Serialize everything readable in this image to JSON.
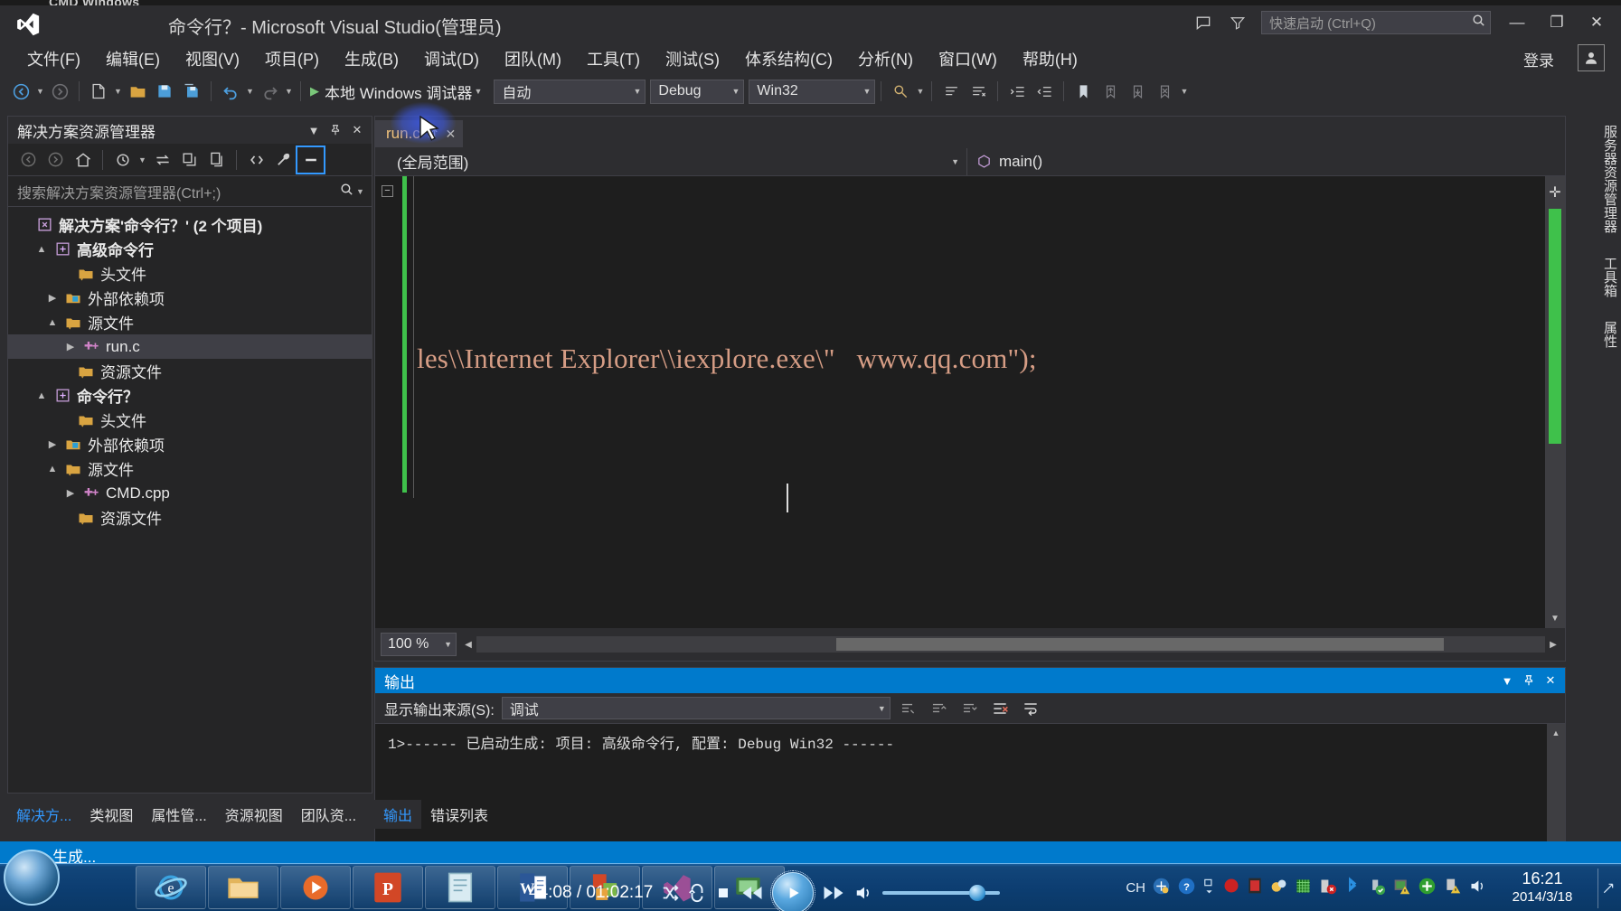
{
  "background": {
    "cmd_window_label": "CMD Windows"
  },
  "titlebar": {
    "title": "命令行？- Microsoft Visual Studio(管理员)",
    "logo_icon": "visual-studio-logo-icon",
    "feedback_icon": "feedback-icon",
    "filter_icon": "filter-icon",
    "quick_launch_placeholder": "快速启动 (Ctrl+Q)",
    "quick_launch_value": "",
    "search_icon": "search-icon",
    "minimize": "—",
    "restore": "❐",
    "close": "✕",
    "signin_label": "登录",
    "account_icon": "account-icon"
  },
  "menubar": {
    "items": [
      {
        "label": "文件(F)"
      },
      {
        "label": "编辑(E)"
      },
      {
        "label": "视图(V)"
      },
      {
        "label": "项目(P)"
      },
      {
        "label": "生成(B)"
      },
      {
        "label": "调试(D)"
      },
      {
        "label": "团队(M)"
      },
      {
        "label": "工具(T)"
      },
      {
        "label": "测试(S)"
      },
      {
        "label": "体系结构(C)"
      },
      {
        "label": "分析(N)"
      },
      {
        "label": "窗口(W)"
      },
      {
        "label": "帮助(H)"
      }
    ]
  },
  "toolbar": {
    "navigate_back_icon": "navigate-back-icon",
    "navigate_forward_icon": "navigate-forward-icon",
    "new_project_icon": "new-project-icon",
    "open_file_icon": "open-file-icon",
    "save_icon": "save-icon",
    "save_all_icon": "save-all-icon",
    "undo_icon": "undo-icon",
    "redo_icon": "redo-icon",
    "start_debug_label": "本地 Windows 调试器",
    "start_debug_icon": "play-icon",
    "debug_target": "自动",
    "configuration": "Debug",
    "platform": "Win32",
    "find_icon": "find-in-files-icon",
    "comment_icon": "comment-icon",
    "uncomment_icon": "uncomment-icon",
    "indent_icon": "indent-icon",
    "outdent_icon": "outdent-icon",
    "bookmark_icon": "bookmark-icon",
    "prev_bookmark_icon": "previous-bookmark-icon",
    "next_bookmark_icon": "next-bookmark-icon",
    "clear_bookmarks_icon": "clear-bookmarks-icon"
  },
  "solution_explorer": {
    "title": "解决方案资源管理器",
    "dropdown_icon": "chevron-down-icon",
    "pin_icon": "pin-icon",
    "close_icon": "close-icon",
    "toolbar": {
      "back_icon": "back-icon",
      "forward_icon": "forward-icon",
      "home_icon": "home-icon",
      "pending_changes_icon": "pending-changes-icon",
      "sync_icon": "sync-with-active-document-icon",
      "refresh_icon": "refresh-icon",
      "collapse_all_icon": "collapse-all-icon",
      "show_all_files_icon": "show-all-files-icon",
      "properties_icon": "properties-wrench-icon",
      "preview_icon": "preview-selected-items-icon"
    },
    "search_placeholder": "搜索解决方案资源管理器(Ctrl+;)",
    "search_value": "",
    "search_icon": "search-icon",
    "tree": [
      {
        "label": "解决方案'命令行？' (2 个项目)",
        "icon": "solution-icon",
        "depth": 0,
        "twisty": "",
        "bold": true,
        "selected": false
      },
      {
        "label": "高级命令行",
        "icon": "project-icon",
        "depth": 1,
        "twisty": "▲",
        "bold": true,
        "selected": false
      },
      {
        "label": "头文件",
        "icon": "folder-filter-icon",
        "depth": 2,
        "twisty": "",
        "bold": false,
        "selected": false
      },
      {
        "label": "外部依赖项",
        "icon": "folder-dependencies-icon",
        "depth": 2,
        "twisty": "▶",
        "bold": false,
        "selected": false
      },
      {
        "label": "源文件",
        "icon": "folder-source-icon",
        "depth": 2,
        "twisty": "▲",
        "bold": false,
        "selected": false
      },
      {
        "label": "run.c",
        "icon": "c-file-icon",
        "depth": 3,
        "twisty": "▶",
        "bold": false,
        "selected": true
      },
      {
        "label": "资源文件",
        "icon": "folder-filter-icon",
        "depth": 2,
        "twisty": "",
        "bold": false,
        "selected": false
      },
      {
        "label": "命令行？",
        "icon": "project-icon",
        "depth": 1,
        "twisty": "▲",
        "bold": true,
        "selected": false
      },
      {
        "label": "头文件",
        "icon": "folder-filter-icon",
        "depth": 2,
        "twisty": "",
        "bold": false,
        "selected": false
      },
      {
        "label": "外部依赖项",
        "icon": "folder-dependencies-icon",
        "depth": 2,
        "twisty": "▶",
        "bold": false,
        "selected": false
      },
      {
        "label": "源文件",
        "icon": "folder-source-icon",
        "depth": 2,
        "twisty": "▲",
        "bold": false,
        "selected": false
      },
      {
        "label": "CMD.cpp",
        "icon": "cpp-file-icon",
        "depth": 3,
        "twisty": "▶",
        "bold": false,
        "selected": false
      },
      {
        "label": "资源文件",
        "icon": "folder-filter-icon",
        "depth": 2,
        "twisty": "",
        "bold": false,
        "selected": false
      }
    ]
  },
  "editor": {
    "tab_label": "run.c",
    "tab_pin_icon": "pin-icon",
    "tab_close_icon": "close-icon",
    "nav_scope": "(全局范围)",
    "nav_member": "main()",
    "nav_member_icon": "method-icon",
    "code_prefix": "les\\\\Internet Explorer\\\\iexplore.exe\\",
    "code_quote": "\"",
    "code_suffix": "   www.qq.com\");",
    "code_full": "les\\\\Internet Explorer\\\\iexplore.exe\\\"   www.qq.com\");",
    "fold_glyph": "−",
    "zoom_level": "100 %",
    "zoom_caret_icon": "chevron-down-icon",
    "changed_marker_color": "#3fc14b",
    "scroll_left_icon": "scroll-left-icon",
    "scroll_right_icon": "scroll-right-icon"
  },
  "output_panel": {
    "title": "输出",
    "dropdown_icon": "chevron-down-icon",
    "pin_icon": "pin-icon",
    "close_icon": "close-icon",
    "source_label": "显示输出来源(S):",
    "source_value": "调试",
    "source_caret_icon": "chevron-down-icon",
    "find_message_icon": "find-message-icon",
    "go_to_prev_icon": "go-to-previous-message-icon",
    "go_to_next_icon": "go-to-next-message-icon",
    "clear_all_icon": "clear-all-icon",
    "toggle_wordwrap_icon": "toggle-word-wrap-icon",
    "lines": [
      "1>------ 已启动生成: 项目: 高级命令行, 配置: Debug Win32 ------"
    ]
  },
  "dock_tabs_left": [
    {
      "label": "解决方...",
      "active": true
    },
    {
      "label": "类视图",
      "active": false
    },
    {
      "label": "属性管...",
      "active": false
    },
    {
      "label": "资源视图",
      "active": false
    },
    {
      "label": "团队资...",
      "active": false
    }
  ],
  "dock_tabs_bottom": [
    {
      "label": "输出",
      "active": true
    },
    {
      "label": "错误列表",
      "active": false
    }
  ],
  "right_vertical_tabs": [
    {
      "label": "服务器资源管理器"
    },
    {
      "label": "工具箱"
    },
    {
      "label": "属性"
    }
  ],
  "statusbar": {
    "text": "生成..."
  },
  "taskbar": {
    "start_icon": "windows-start-orb-icon",
    "items": [
      {
        "icon": "internet-explorer-icon"
      },
      {
        "icon": "file-explorer-icon"
      },
      {
        "icon": "media-player-icon"
      },
      {
        "icon": "powerpoint-icon"
      },
      {
        "icon": "notepad-icon"
      },
      {
        "icon": "word-icon"
      },
      {
        "icon": "office-suite-icon"
      },
      {
        "icon": "visual-studio-icon"
      },
      {
        "icon": "screen-recorder-icon"
      }
    ],
    "tray": {
      "input_indicator": "CH",
      "icons": [
        "sogou-pinyin-icon",
        "help-icon",
        "show-hidden-icons-icon",
        "stop-recording-icon",
        "camtasia-icon",
        "messenger-icon",
        "network-grid-icon",
        "firewall-blocked-icon",
        "bluetooth-icon",
        "usb-safe-remove-icon",
        "antivirus-warning-icon",
        "update-icon",
        "action-center-warning-icon",
        "volume-icon"
      ],
      "clock_time": "16:21",
      "clock_date": "2014/3/18",
      "show_desktop_icon": "show-desktop-icon"
    }
  },
  "media_player": {
    "elapsed_total": "44:08 / 01:02:17",
    "shuffle_icon": "shuffle-icon",
    "repeat_icon": "repeat-icon",
    "stop_icon": "stop-icon",
    "previous_icon": "previous-track-icon",
    "play_icon": "play-icon",
    "next_icon": "next-track-icon",
    "volume_icon": "volume-icon"
  },
  "colors": {
    "accent": "#007acc",
    "window_bg": "#2d2d30",
    "editor_bg": "#1e1e1e",
    "string_literal": "#d69d85",
    "changed_line": "#3fc14b",
    "tab_text": "#f0c27d",
    "link": "#3399ff"
  }
}
